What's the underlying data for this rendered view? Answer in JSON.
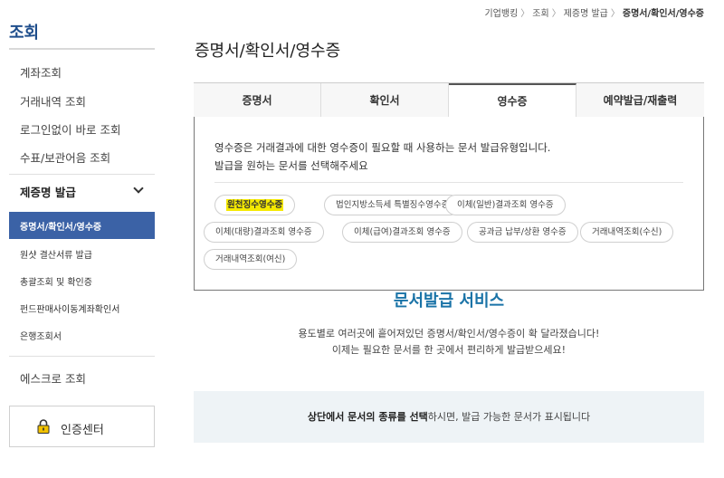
{
  "sidebar": {
    "title": "조회",
    "items": [
      "계좌조회",
      "거래내역 조회",
      "로그인없이 바로 조회",
      "수표/보관어음 조회"
    ],
    "group_label": "제증명 발급",
    "sub_items": [
      {
        "label": "증명서/확인서/영수증",
        "active": true
      },
      {
        "label": "원샷 결산서류 발급",
        "active": false
      },
      {
        "label": "총괄조회 및 확인증",
        "active": false
      },
      {
        "label": "펀드판매사이동계좌확인서",
        "active": false
      },
      {
        "label": "은행조회서",
        "active": false
      }
    ],
    "escrow": "에스크로 조회",
    "cert_center": "인증센터"
  },
  "breadcrumb": [
    "기업뱅킹",
    "조회",
    "제증명 발급",
    "증명서/확인서/영수증"
  ],
  "page_title": "증명서/확인서/영수증",
  "tabs": [
    {
      "label": "증명서",
      "active": false
    },
    {
      "label": "확인서",
      "active": false
    },
    {
      "label": "영수증",
      "active": true
    },
    {
      "label": "예약발급/재출력",
      "active": false
    }
  ],
  "panel": {
    "desc_line1": "영수증은 거래결과에 대한 영수증이 필요할 때 사용하는 문서 발급유형입니다.",
    "desc_line2": "발급을 원하는 문서를 선택해주세요",
    "chips": [
      "원천징수영수증",
      "법인지방소득세 특별징수영수증",
      "이체(일반)결과조회 영수증",
      "이체(대량)결과조회 영수증",
      "이체(급여)결과조회 영수증",
      "공과금 납부/상환 영수증",
      "거래내역조회(수신)",
      "거래내역조회(여신)"
    ]
  },
  "service": {
    "title": "문서발급 서비스",
    "line1": "용도별로 여러곳에 흩어져있던 증명서/확인서/영수증이 확 달라졌습니다!",
    "line2": "이제는 필요한 문서를 한 곳에서 편리하게 발급받으세요!"
  },
  "info": {
    "bold": "상단에서 문서의 종류를 선택",
    "rest": "하시면, 발급 가능한 문서가 표시됩니다"
  },
  "colors": {
    "sidebar_active": "#3b62a6",
    "title_blue": "#1a73a7",
    "highlight": "#f5e900",
    "info_bg": "#eef3f6"
  }
}
